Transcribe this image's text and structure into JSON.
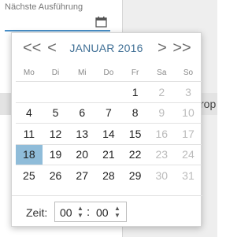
{
  "field": {
    "label": "Nächste Ausführung"
  },
  "background": {
    "partial_text": "rop"
  },
  "calendar": {
    "nav": {
      "prev_year": "<<",
      "prev_month": "<",
      "next_month": ">",
      "next_year": ">>"
    },
    "title": "JANUAR 2016",
    "weekdays": [
      "Mo",
      "Di",
      "Mi",
      "Do",
      "Fr",
      "Sa",
      "So"
    ],
    "weeks": [
      [
        "",
        "",
        "",
        "",
        "1",
        "2",
        "3"
      ],
      [
        "4",
        "5",
        "6",
        "7",
        "8",
        "9",
        "10"
      ],
      [
        "11",
        "12",
        "13",
        "14",
        "15",
        "16",
        "17"
      ],
      [
        "18",
        "19",
        "20",
        "21",
        "22",
        "23",
        "24"
      ],
      [
        "25",
        "26",
        "27",
        "28",
        "29",
        "30",
        "31"
      ]
    ],
    "selected_day": "18"
  },
  "time": {
    "label": "Zeit:",
    "hours": "00",
    "minutes": "00",
    "separator": ":"
  },
  "colors": {
    "accent": "#4a90c8",
    "selected": "#8fbcd9",
    "title": "#3f6f95"
  }
}
